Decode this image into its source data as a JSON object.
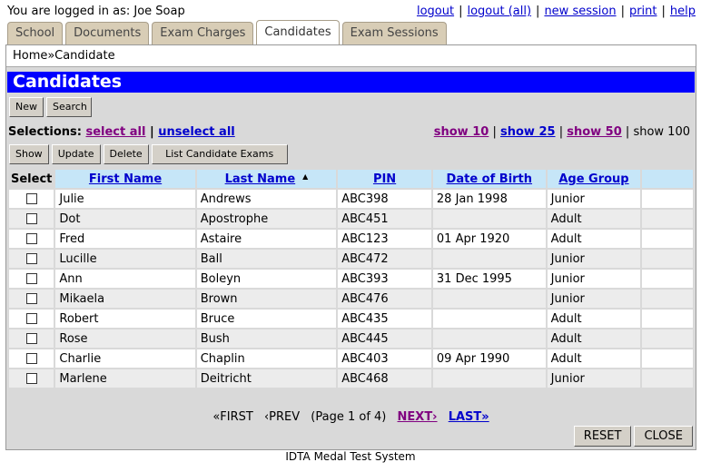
{
  "header": {
    "login_text": "You are logged in as: Joe Soap",
    "links": [
      "logout",
      "logout (all)",
      "new session",
      "print",
      "help"
    ]
  },
  "tabs": [
    {
      "label": "School",
      "active": false
    },
    {
      "label": "Documents",
      "active": false
    },
    {
      "label": "Exam Charges",
      "active": false
    },
    {
      "label": "Candidates",
      "active": true
    },
    {
      "label": "Exam Sessions",
      "active": false
    }
  ],
  "breadcrumb": "Home»Candidate",
  "page_title": "Candidates",
  "toolbar": {
    "new_label": "New",
    "search_label": "Search"
  },
  "selections": {
    "label": "Selections:",
    "select_all": "select all",
    "separator": "|",
    "unselect_all": "unselect all"
  },
  "show_links": {
    "show10": "show 10",
    "show25": "show 25",
    "show50": "show 50",
    "current": "show 100",
    "separator": "|"
  },
  "actions": {
    "show_label": "Show",
    "update_label": "Update",
    "delete_label": "Delete",
    "list_exams_label": "List Candidate Exams"
  },
  "table": {
    "headers": {
      "select": "Select",
      "first_name": "First Name",
      "last_name": "Last Name",
      "pin": "PIN",
      "dob": "Date of Birth",
      "age_group": "Age Group"
    },
    "rows": [
      {
        "first": "Julie",
        "last": "Andrews",
        "pin": "ABC398",
        "dob": "28 Jan 1998",
        "age": "Junior"
      },
      {
        "first": "Dot",
        "last": "Apostrophe",
        "pin": "ABC451",
        "dob": "",
        "age": "Adult"
      },
      {
        "first": "Fred",
        "last": "Astaire",
        "pin": "ABC123",
        "dob": "01 Apr 1920",
        "age": "Adult"
      },
      {
        "first": "Lucille",
        "last": "Ball",
        "pin": "ABC472",
        "dob": "",
        "age": "Junior"
      },
      {
        "first": "Ann",
        "last": "Boleyn",
        "pin": "ABC393",
        "dob": "31 Dec 1995",
        "age": "Junior"
      },
      {
        "first": "Mikaela",
        "last": "Brown",
        "pin": "ABC476",
        "dob": "",
        "age": "Junior"
      },
      {
        "first": "Robert",
        "last": "Bruce",
        "pin": "ABC435",
        "dob": "",
        "age": "Adult"
      },
      {
        "first": "Rose",
        "last": "Bush",
        "pin": "ABC445",
        "dob": "",
        "age": "Adult"
      },
      {
        "first": "Charlie",
        "last": "Chaplin",
        "pin": "ABC403",
        "dob": "09 Apr 1990",
        "age": "Adult"
      },
      {
        "first": "Marlene",
        "last": "Deitricht",
        "pin": "ABC468",
        "dob": "",
        "age": "Junior"
      }
    ]
  },
  "pager": {
    "first": "«FIRST",
    "prev": "‹PREV",
    "page_info": "(Page 1 of 4)",
    "next": "NEXT›",
    "last": "LAST»"
  },
  "bottom": {
    "reset_label": "RESET",
    "close_label": "CLOSE"
  },
  "footer": "IDTA Medal Test System"
}
